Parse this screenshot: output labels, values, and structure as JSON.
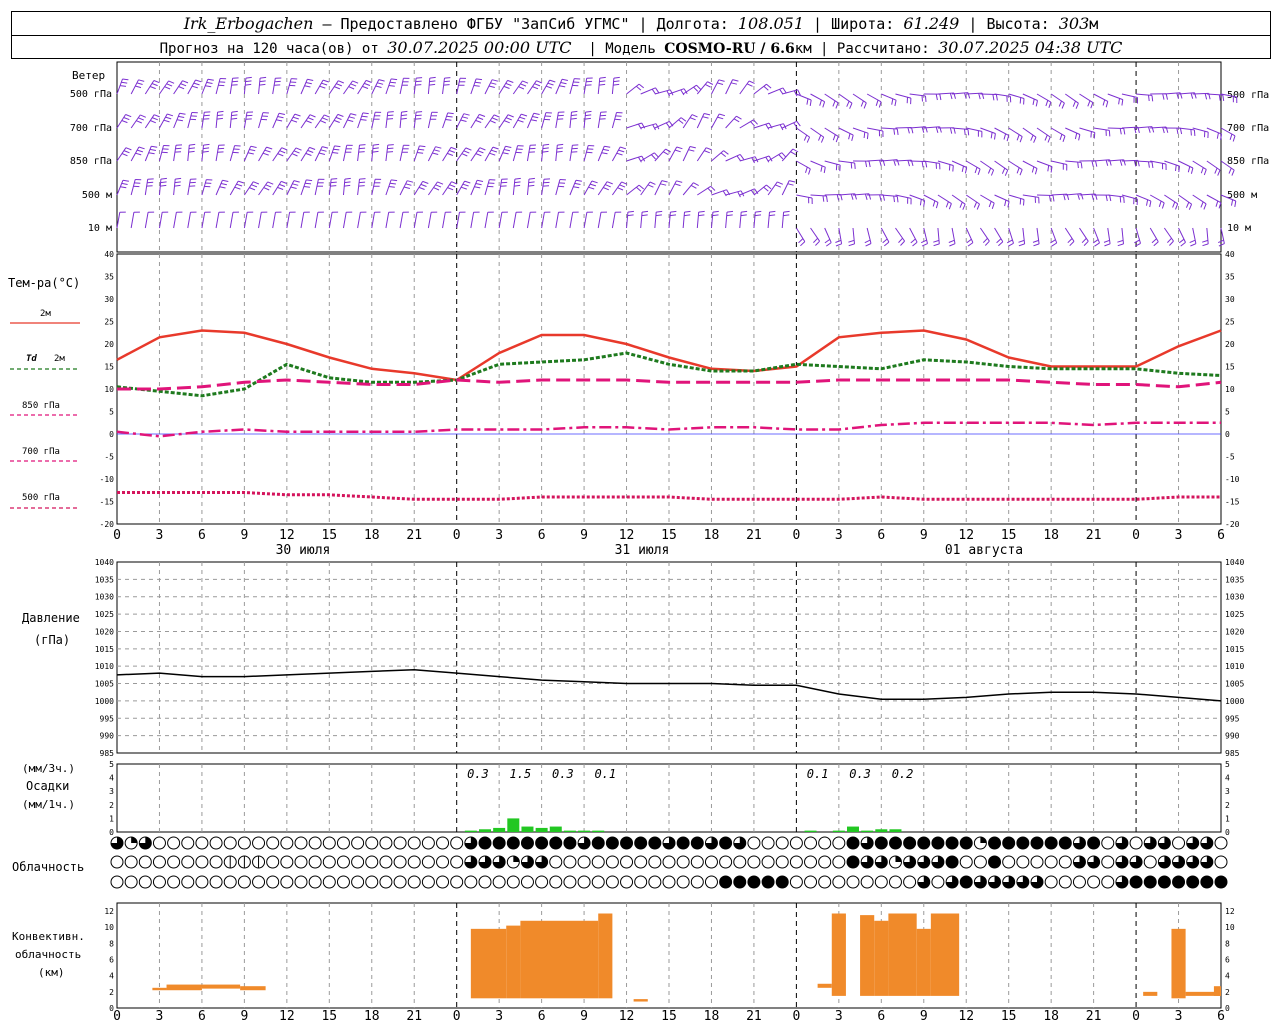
{
  "header": {
    "station": "Irk_Erbogachen",
    "provider": "– Предоставлено ФГБУ \"ЗапСиб УГМС\"",
    "lon_label": "Долгота:",
    "lon": "108.051",
    "lat_label": "Широта:",
    "lat": "61.249",
    "alt_label": "Высота:",
    "alt": "303",
    "alt_unit": "м",
    "forecast_label": "Прогноз на 120 часа(ов) от",
    "forecast_time": "30.07.2025 00:00 UTC",
    "model_label": "Модель",
    "model": "COSMO-RU / 6.6",
    "model_unit": "км",
    "calc_label": "Рассчитано:",
    "calc_time": "30.07.2025 04:38 UTC"
  },
  "colors": {
    "wind": "#7b2fd0",
    "t2m": "#e8392b",
    "td2m": "#1e7a1e",
    "t850": "#e0147a",
    "t700": "#e0147a",
    "t500": "#d4145c",
    "precip": "#22c722",
    "conv": "#f08a2a",
    "grid": "#9a9a9a"
  },
  "time_axis": {
    "hour_ticks": [
      "0",
      "3",
      "6",
      "9",
      "12",
      "15",
      "18",
      "21",
      "0",
      "3",
      "6",
      "9",
      "12",
      "15",
      "18",
      "21",
      "0",
      "3",
      "6",
      "9",
      "12",
      "15",
      "18",
      "21",
      "0",
      "3",
      "6"
    ],
    "days": [
      "30 июля",
      "31 июля",
      "01 августа"
    ]
  },
  "labels": {
    "wind": "Ветер",
    "wind_levels": [
      "500 гПа",
      "700 гПа",
      "850 гПа",
      "500 м",
      "10 м"
    ],
    "temp": "Тем-ра(°C)",
    "t2m": "2м",
    "td": "Td",
    "td_level": "2м",
    "t850": "850 гПа",
    "t700": "700 гПа",
    "t500": "500 гПа",
    "pressure": "Давление",
    "pressure_unit": "(гПа)",
    "precip_unit3": "(мм/3ч.)",
    "precip": "Осадки",
    "precip_unit1": "(мм/1ч.)",
    "cloud": "Облачность",
    "conv1": "Конвективн.",
    "conv2": "облачность",
    "conv3": "(км)"
  },
  "chart_data": [
    {
      "type": "line",
      "title": "Тем-ра(°C)",
      "ylim": [
        -20,
        40
      ],
      "yticks": [
        -20,
        -15,
        -10,
        -5,
        0,
        5,
        10,
        15,
        20,
        25,
        30,
        35,
        40
      ],
      "x_hours": [
        0,
        3,
        6,
        9,
        12,
        15,
        18,
        21,
        24,
        27,
        30,
        33,
        36,
        39,
        42,
        45,
        48,
        51,
        54,
        57,
        60,
        63,
        66,
        69,
        72,
        75,
        78
      ],
      "series": [
        {
          "name": "2м",
          "values": [
            16.5,
            21.5,
            23,
            22.5,
            20,
            17,
            14.5,
            13.5,
            12,
            18,
            22,
            22,
            20,
            17,
            14.5,
            14,
            15,
            21.5,
            22.5,
            23,
            21,
            17,
            15,
            15,
            15,
            19.5,
            23
          ]
        },
        {
          "name": "Td 2м",
          "values": [
            10.5,
            9.5,
            8.5,
            10,
            15.5,
            12.5,
            11.5,
            11.5,
            12,
            15.5,
            16,
            16.5,
            18,
            15.5,
            14,
            14,
            15.5,
            15,
            14.5,
            16.5,
            16,
            15,
            14.5,
            14.5,
            14.5,
            13.5,
            13
          ]
        },
        {
          "name": "850 гПа",
          "values": [
            10,
            10,
            10.5,
            11.5,
            12,
            11.5,
            11,
            11,
            12,
            11.5,
            12,
            12,
            12,
            11.5,
            11.5,
            11.5,
            11.5,
            12,
            12,
            12,
            12,
            12,
            11.5,
            11,
            11,
            10.5,
            11.5
          ]
        },
        {
          "name": "700 гПа",
          "values": [
            0.5,
            -0.5,
            0.5,
            1,
            0.5,
            0.5,
            0.5,
            0.5,
            1,
            1,
            1,
            1.5,
            1.5,
            1,
            1.5,
            1.5,
            1,
            1,
            2,
            2.5,
            2.5,
            2.5,
            2.5,
            2,
            2.5,
            2.5,
            2.5
          ]
        },
        {
          "name": "500 гПа",
          "values": [
            -13,
            -13,
            -13,
            -13,
            -13.5,
            -13.5,
            -14,
            -14.5,
            -14.5,
            -14.5,
            -14,
            -14,
            -14,
            -14,
            -14.5,
            -14.5,
            -14.5,
            -14.5,
            -14,
            -14.5,
            -14.5,
            -14.5,
            -14.5,
            -14.5,
            -14.5,
            -14,
            -14
          ]
        }
      ]
    },
    {
      "type": "line",
      "title": "Давление",
      "ylabel": "(гПа)",
      "ylim": [
        985,
        1040
      ],
      "yticks": [
        985,
        990,
        995,
        1000,
        1005,
        1010,
        1015,
        1020,
        1025,
        1030,
        1035,
        1040
      ],
      "x_hours": [
        0,
        3,
        6,
        9,
        12,
        15,
        18,
        21,
        24,
        27,
        30,
        33,
        36,
        39,
        42,
        45,
        48,
        51,
        54,
        57,
        60,
        63,
        66,
        69,
        72,
        75,
        78
      ],
      "series": [
        {
          "name": "Давление",
          "values": [
            1007.5,
            1008,
            1007,
            1007,
            1007.5,
            1008,
            1008.5,
            1009,
            1008,
            1007,
            1006,
            1005.5,
            1005,
            1005,
            1005,
            1004.5,
            1004.5,
            1002,
            1000.5,
            1000.5,
            1001,
            1002,
            1002.5,
            1002.5,
            1002,
            1001,
            1000
          ]
        }
      ]
    },
    {
      "type": "bar",
      "title": "Осадки",
      "ylim": [
        0,
        5
      ],
      "yticks": [
        0,
        1,
        2,
        3,
        4,
        5
      ],
      "x_hours": [
        25,
        26,
        27,
        28,
        29,
        30,
        31,
        32,
        33,
        34,
        49,
        51,
        52,
        53,
        54,
        55
      ],
      "values": [
        0.1,
        0.2,
        0.3,
        1.0,
        0.4,
        0.3,
        0.4,
        0.1,
        0.1,
        0.1,
        0.1,
        0.1,
        0.4,
        0.1,
        0.2,
        0.2
      ],
      "annotations": [
        {
          "x": 25.5,
          "label": "0.3"
        },
        {
          "x": 28.5,
          "label": "1.5"
        },
        {
          "x": 31.5,
          "label": "0.3"
        },
        {
          "x": 34.5,
          "label": "0.1"
        },
        {
          "x": 49.5,
          "label": "0.1"
        },
        {
          "x": 52.5,
          "label": "0.3"
        },
        {
          "x": 55.5,
          "label": "0.2"
        }
      ]
    },
    {
      "type": "bar",
      "title": "Конвективн. облачность (км)",
      "ylim": [
        0,
        13
      ],
      "yticks": [
        0,
        2,
        4,
        6,
        8,
        10,
        12
      ],
      "bars": [
        {
          "x0": 2.5,
          "x1": 3.5,
          "bottom": 2.2,
          "top": 2.5
        },
        {
          "x0": 3.5,
          "x1": 6,
          "bottom": 2.2,
          "top": 2.9
        },
        {
          "x0": 6,
          "x1": 8.7,
          "bottom": 2.4,
          "top": 2.9
        },
        {
          "x0": 8.7,
          "x1": 10.5,
          "bottom": 2.2,
          "top": 2.7
        },
        {
          "x0": 25,
          "x1": 27.5,
          "bottom": 1.2,
          "top": 9.8
        },
        {
          "x0": 27.5,
          "x1": 28.5,
          "bottom": 1.2,
          "top": 10.2
        },
        {
          "x0": 28.5,
          "x1": 34,
          "bottom": 1.2,
          "top": 10.8
        },
        {
          "x0": 34,
          "x1": 35,
          "bottom": 1.2,
          "top": 11.7
        },
        {
          "x0": 36.5,
          "x1": 37.5,
          "bottom": 0.8,
          "top": 1.1
        },
        {
          "x0": 49.5,
          "x1": 50.5,
          "bottom": 2.5,
          "top": 3.0
        },
        {
          "x0": 50.5,
          "x1": 51.5,
          "bottom": 1.5,
          "top": 11.7
        },
        {
          "x0": 52.5,
          "x1": 53.5,
          "bottom": 1.5,
          "top": 11.5
        },
        {
          "x0": 53.5,
          "x1": 54.5,
          "bottom": 1.5,
          "top": 10.8
        },
        {
          "x0": 54.5,
          "x1": 56.5,
          "bottom": 1.5,
          "top": 11.7
        },
        {
          "x0": 56.5,
          "x1": 57.5,
          "bottom": 1.5,
          "top": 9.8
        },
        {
          "x0": 57.5,
          "x1": 59.5,
          "bottom": 1.5,
          "top": 11.7
        },
        {
          "x0": 72.5,
          "x1": 73.5,
          "bottom": 1.5,
          "top": 2.0
        },
        {
          "x0": 74.5,
          "x1": 75.5,
          "bottom": 1.2,
          "top": 9.8
        },
        {
          "x0": 75.5,
          "x1": 78,
          "bottom": 1.5,
          "top": 2.0
        },
        {
          "x0": 77.5,
          "x1": 78,
          "bottom": 1.5,
          "top": 2.7
        }
      ]
    },
    {
      "type": "table",
      "title": "Облачность",
      "note": "octa codes 0-8 per hour, rows: top(upper), middle, bottom(lower)",
      "rows": [
        "626000000000000000000000068888888688888788686000000086888888828888886806066066000",
        "000000001110000000000000066626600000000000000000000086626668008000006606606666000",
        "000000000000000000000000000000000000000000088888000000000606866666000006888888888"
      ]
    }
  ]
}
